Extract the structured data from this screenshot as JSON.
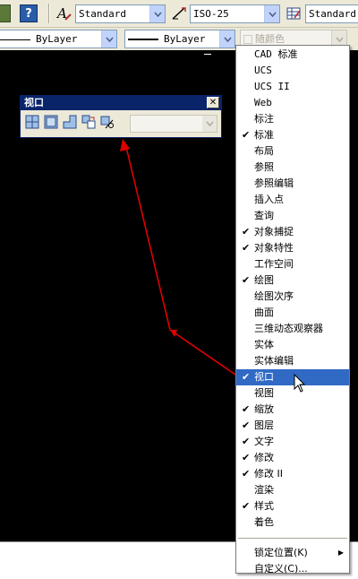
{
  "toolbar1": {
    "text_style": "Standard",
    "dim_style": "ISO-25",
    "table_style": "Standard"
  },
  "toolbar2": {
    "linetype": "ByLayer",
    "lineweight": "ByLayer",
    "color": "随颜色"
  },
  "viewport_toolbar": {
    "title": "视口",
    "close_symbol": "✕"
  },
  "menu": {
    "items": [
      {
        "label": "CAD 标准",
        "checked": false
      },
      {
        "label": "UCS",
        "checked": false
      },
      {
        "label": "UCS II",
        "checked": false
      },
      {
        "label": "Web",
        "checked": false
      },
      {
        "label": "标注",
        "checked": false
      },
      {
        "label": "标准",
        "checked": true
      },
      {
        "label": "布局",
        "checked": false
      },
      {
        "label": "参照",
        "checked": false
      },
      {
        "label": "参照编辑",
        "checked": false
      },
      {
        "label": "插入点",
        "checked": false
      },
      {
        "label": "查询",
        "checked": false
      },
      {
        "label": "对象捕捉",
        "checked": true
      },
      {
        "label": "对象特性",
        "checked": true
      },
      {
        "label": "工作空间",
        "checked": false
      },
      {
        "label": "绘图",
        "checked": true
      },
      {
        "label": "绘图次序",
        "checked": false
      },
      {
        "label": "曲面",
        "checked": false
      },
      {
        "label": "三维动态观察器",
        "checked": false
      },
      {
        "label": "实体",
        "checked": false
      },
      {
        "label": "实体编辑",
        "checked": false
      },
      {
        "label": "视口",
        "checked": true,
        "selected": true
      },
      {
        "label": "视图",
        "checked": false
      },
      {
        "label": "缩放",
        "checked": true
      },
      {
        "label": "图层",
        "checked": true
      },
      {
        "label": "文字",
        "checked": true
      },
      {
        "label": "修改",
        "checked": true
      },
      {
        "label": "修改 II",
        "checked": true
      },
      {
        "label": "渲染",
        "checked": false
      },
      {
        "label": "样式",
        "checked": true
      },
      {
        "label": "着色",
        "checked": false
      }
    ],
    "lock_position": "锁定位置(K)",
    "customize": "自定义(C)...",
    "check_mark": "✔",
    "submenu_arrow": "▶"
  },
  "colors": {
    "canvas": "#000000",
    "menu_highlight": "#316ac5",
    "arrow": "#e00000",
    "title_bar": "#0a246a"
  }
}
